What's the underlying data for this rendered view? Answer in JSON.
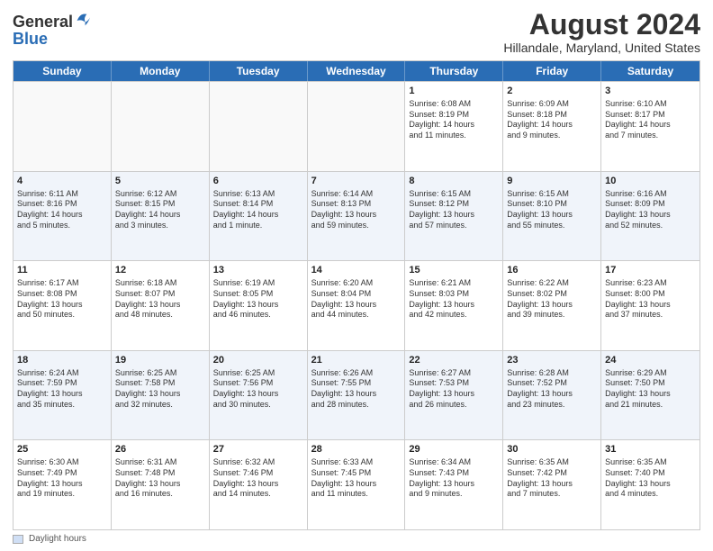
{
  "header": {
    "logo_general": "General",
    "logo_blue": "Blue",
    "main_title": "August 2024",
    "subtitle": "Hillandale, Maryland, United States"
  },
  "days_of_week": [
    "Sunday",
    "Monday",
    "Tuesday",
    "Wednesday",
    "Thursday",
    "Friday",
    "Saturday"
  ],
  "weeks": [
    [
      {
        "day": "",
        "info": "",
        "empty": true
      },
      {
        "day": "",
        "info": "",
        "empty": true
      },
      {
        "day": "",
        "info": "",
        "empty": true
      },
      {
        "day": "",
        "info": "",
        "empty": true
      },
      {
        "day": "1",
        "info": "Sunrise: 6:08 AM\nSunset: 8:19 PM\nDaylight: 14 hours\nand 11 minutes."
      },
      {
        "day": "2",
        "info": "Sunrise: 6:09 AM\nSunset: 8:18 PM\nDaylight: 14 hours\nand 9 minutes."
      },
      {
        "day": "3",
        "info": "Sunrise: 6:10 AM\nSunset: 8:17 PM\nDaylight: 14 hours\nand 7 minutes."
      }
    ],
    [
      {
        "day": "4",
        "info": "Sunrise: 6:11 AM\nSunset: 8:16 PM\nDaylight: 14 hours\nand 5 minutes."
      },
      {
        "day": "5",
        "info": "Sunrise: 6:12 AM\nSunset: 8:15 PM\nDaylight: 14 hours\nand 3 minutes."
      },
      {
        "day": "6",
        "info": "Sunrise: 6:13 AM\nSunset: 8:14 PM\nDaylight: 14 hours\nand 1 minute."
      },
      {
        "day": "7",
        "info": "Sunrise: 6:14 AM\nSunset: 8:13 PM\nDaylight: 13 hours\nand 59 minutes."
      },
      {
        "day": "8",
        "info": "Sunrise: 6:15 AM\nSunset: 8:12 PM\nDaylight: 13 hours\nand 57 minutes."
      },
      {
        "day": "9",
        "info": "Sunrise: 6:15 AM\nSunset: 8:10 PM\nDaylight: 13 hours\nand 55 minutes."
      },
      {
        "day": "10",
        "info": "Sunrise: 6:16 AM\nSunset: 8:09 PM\nDaylight: 13 hours\nand 52 minutes."
      }
    ],
    [
      {
        "day": "11",
        "info": "Sunrise: 6:17 AM\nSunset: 8:08 PM\nDaylight: 13 hours\nand 50 minutes."
      },
      {
        "day": "12",
        "info": "Sunrise: 6:18 AM\nSunset: 8:07 PM\nDaylight: 13 hours\nand 48 minutes."
      },
      {
        "day": "13",
        "info": "Sunrise: 6:19 AM\nSunset: 8:05 PM\nDaylight: 13 hours\nand 46 minutes."
      },
      {
        "day": "14",
        "info": "Sunrise: 6:20 AM\nSunset: 8:04 PM\nDaylight: 13 hours\nand 44 minutes."
      },
      {
        "day": "15",
        "info": "Sunrise: 6:21 AM\nSunset: 8:03 PM\nDaylight: 13 hours\nand 42 minutes."
      },
      {
        "day": "16",
        "info": "Sunrise: 6:22 AM\nSunset: 8:02 PM\nDaylight: 13 hours\nand 39 minutes."
      },
      {
        "day": "17",
        "info": "Sunrise: 6:23 AM\nSunset: 8:00 PM\nDaylight: 13 hours\nand 37 minutes."
      }
    ],
    [
      {
        "day": "18",
        "info": "Sunrise: 6:24 AM\nSunset: 7:59 PM\nDaylight: 13 hours\nand 35 minutes."
      },
      {
        "day": "19",
        "info": "Sunrise: 6:25 AM\nSunset: 7:58 PM\nDaylight: 13 hours\nand 32 minutes."
      },
      {
        "day": "20",
        "info": "Sunrise: 6:25 AM\nSunset: 7:56 PM\nDaylight: 13 hours\nand 30 minutes."
      },
      {
        "day": "21",
        "info": "Sunrise: 6:26 AM\nSunset: 7:55 PM\nDaylight: 13 hours\nand 28 minutes."
      },
      {
        "day": "22",
        "info": "Sunrise: 6:27 AM\nSunset: 7:53 PM\nDaylight: 13 hours\nand 26 minutes."
      },
      {
        "day": "23",
        "info": "Sunrise: 6:28 AM\nSunset: 7:52 PM\nDaylight: 13 hours\nand 23 minutes."
      },
      {
        "day": "24",
        "info": "Sunrise: 6:29 AM\nSunset: 7:50 PM\nDaylight: 13 hours\nand 21 minutes."
      }
    ],
    [
      {
        "day": "25",
        "info": "Sunrise: 6:30 AM\nSunset: 7:49 PM\nDaylight: 13 hours\nand 19 minutes."
      },
      {
        "day": "26",
        "info": "Sunrise: 6:31 AM\nSunset: 7:48 PM\nDaylight: 13 hours\nand 16 minutes."
      },
      {
        "day": "27",
        "info": "Sunrise: 6:32 AM\nSunset: 7:46 PM\nDaylight: 13 hours\nand 14 minutes."
      },
      {
        "day": "28",
        "info": "Sunrise: 6:33 AM\nSunset: 7:45 PM\nDaylight: 13 hours\nand 11 minutes."
      },
      {
        "day": "29",
        "info": "Sunrise: 6:34 AM\nSunset: 7:43 PM\nDaylight: 13 hours\nand 9 minutes."
      },
      {
        "day": "30",
        "info": "Sunrise: 6:35 AM\nSunset: 7:42 PM\nDaylight: 13 hours\nand 7 minutes."
      },
      {
        "day": "31",
        "info": "Sunrise: 6:35 AM\nSunset: 7:40 PM\nDaylight: 13 hours\nand 4 minutes."
      }
    ]
  ],
  "footer": {
    "legend_label": "Daylight hours"
  }
}
